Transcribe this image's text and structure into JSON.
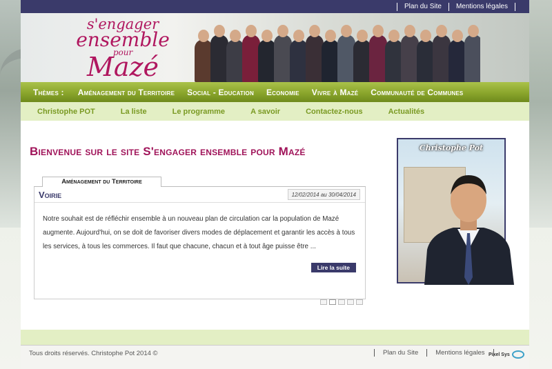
{
  "topbar": {
    "links": [
      "Plan du Site",
      "Mentions légales"
    ]
  },
  "logo": {
    "line1": "s'engager",
    "line2": "ensemble",
    "line3": "pour",
    "line4": "Mazé"
  },
  "themes": {
    "label": "Thèmes :",
    "items": [
      "Aménagement du Territoire",
      "Social - Education",
      "Economie",
      "Vivre à Mazé",
      "Communauté de Communes"
    ]
  },
  "subnav": {
    "items": [
      "Christophe POT",
      "La liste",
      "Le programme",
      "A savoir",
      "Contactez-nous",
      "Actualités"
    ]
  },
  "main": {
    "welcome": "Bienvenue sur le site S'engager ensemble pour Mazé",
    "tab_label": "Aménagement du Territoire",
    "article": {
      "title": "Voirie",
      "date": "12/02/2014 au 30/04/2014",
      "text": "Notre souhait est de réfléchir ensemble à un nouveau plan de circulation car la population de Mazé augmente. Aujourd'hui, on se doit de favoriser divers modes de déplacement et garantir les accès à tous les services, à tous les commerces. Il faut que chacune, chacun et à tout âge puisse être ...",
      "read_more": "Lire la suite"
    },
    "pager": {
      "count": 5,
      "active": 1
    },
    "portrait_name": "Christophe Pot"
  },
  "footer": {
    "copyright": "Tous droits réservés. Christophe Pot 2014 ©",
    "links": [
      "Plan du Site",
      "Mentions légales"
    ],
    "credit": "Pixel Sys"
  },
  "colors": {
    "brand": "#b0175f",
    "navy": "#3a3a6a",
    "green": "#8aa52c",
    "light_green": "#e3efc4"
  }
}
